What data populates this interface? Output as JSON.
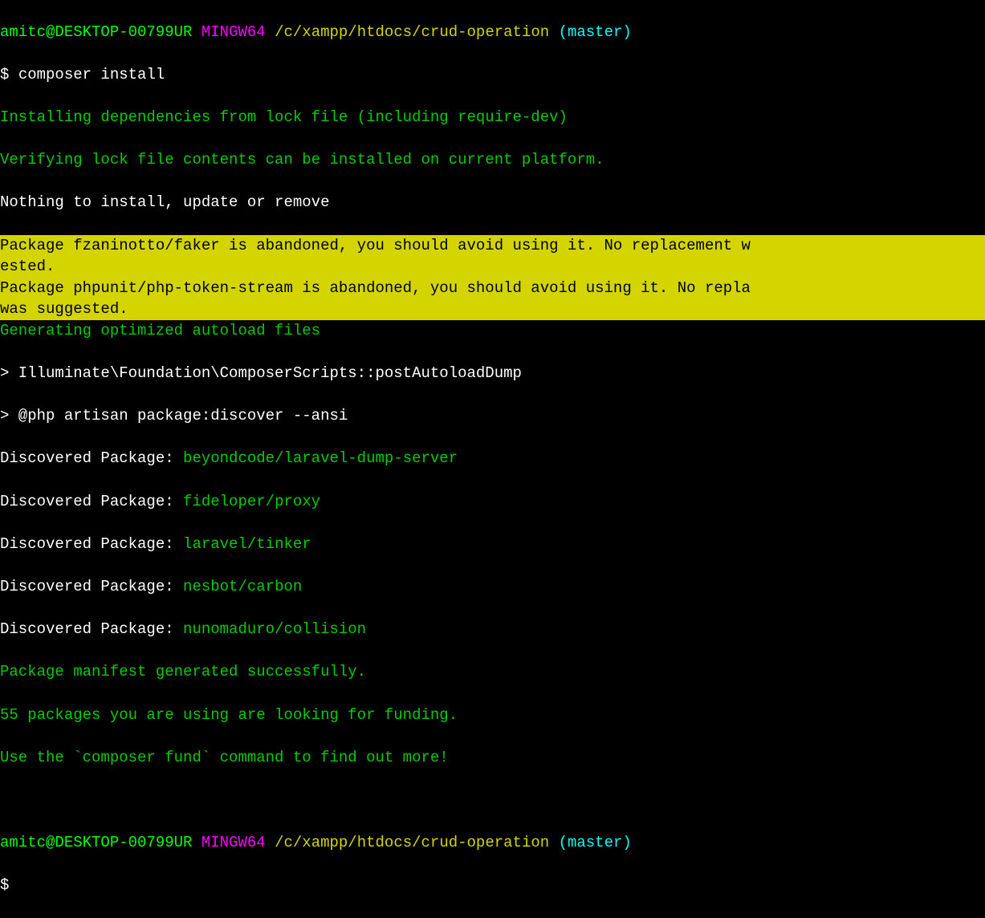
{
  "prompt1": {
    "userHost": "amitc@DESKTOP-00799UR",
    "mingw": "MINGW64",
    "path": "/c/xampp/htdocs/crud-operation",
    "branch": "(master)",
    "dollar": "$",
    "command": "composer install"
  },
  "output": {
    "line1": "Installing dependencies from lock file (including require-dev)",
    "line2": "Verifying lock file contents can be installed on current platform.",
    "line3": "Nothing to install, update or remove",
    "warn1": "Package fzaninotto/faker is abandoned, you should avoid using it. No replacement w",
    "warn2": "ested.",
    "warn3": "Package phpunit/php-token-stream is abandoned, you should avoid using it. No repla",
    "warn4": "was suggested.",
    "line4": "Generating optimized autoload files",
    "line5": "> Illuminate\\Foundation\\ComposerScripts::postAutoloadDump",
    "line6": "> @php artisan package:discover --ansi",
    "discoveredLabel": "Discovered Package: ",
    "packages": [
      "beyondcode/laravel-dump-server",
      "fideloper/proxy",
      "laravel/tinker",
      "nesbot/carbon",
      "nunomaduro/collision"
    ],
    "line7": "Package manifest generated successfully.",
    "line8": "55 packages you are using are looking for funding.",
    "line9": "Use the `composer fund` command to find out more!"
  },
  "prompt2": {
    "userHost": "amitc@DESKTOP-00799UR",
    "mingw": "MINGW64",
    "path": "/c/xampp/htdocs/crud-operation",
    "branch": "(master)",
    "dollar": "$"
  }
}
